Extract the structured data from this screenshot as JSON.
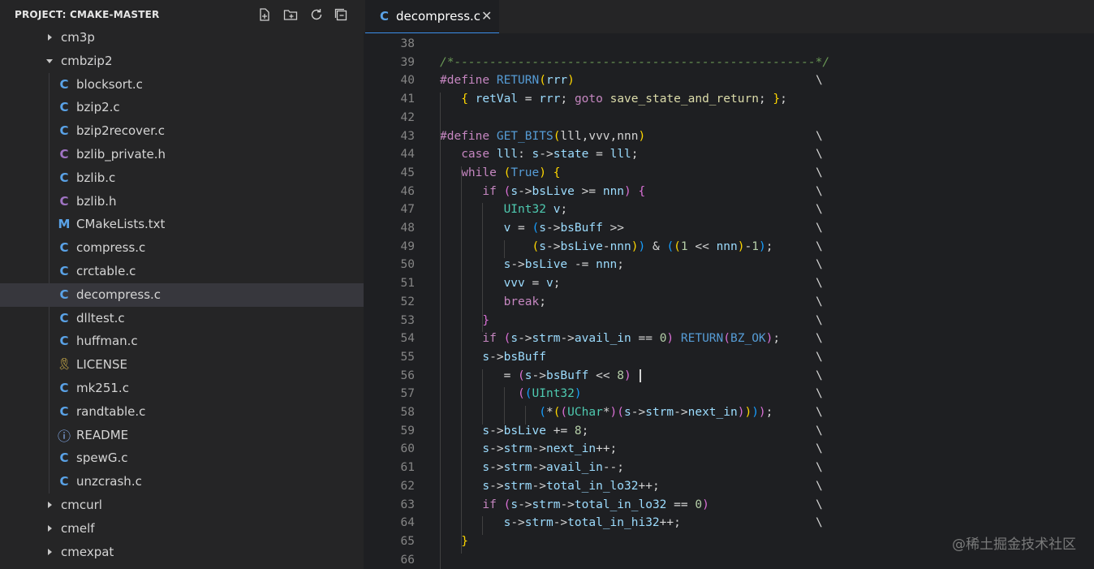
{
  "sidebar": {
    "title": "PROJECT: CMAKE-MASTER",
    "actions": [
      {
        "name": "new-file-icon"
      },
      {
        "name": "new-folder-icon"
      },
      {
        "name": "refresh-icon"
      },
      {
        "name": "collapse-all-icon"
      }
    ],
    "tree": [
      {
        "label": "cm3p",
        "type": "folder",
        "expanded": false
      },
      {
        "label": "cmbzip2",
        "type": "folder",
        "expanded": true
      },
      {
        "label": "blocksort.c",
        "type": "c",
        "icon_glyph": "C"
      },
      {
        "label": "bzip2.c",
        "type": "c",
        "icon_glyph": "C"
      },
      {
        "label": "bzip2recover.c",
        "type": "c",
        "icon_glyph": "C"
      },
      {
        "label": "bzlib_private.h",
        "type": "h",
        "icon_glyph": "C"
      },
      {
        "label": "bzlib.c",
        "type": "c",
        "icon_glyph": "C"
      },
      {
        "label": "bzlib.h",
        "type": "h",
        "icon_glyph": "C"
      },
      {
        "label": "CMakeLists.txt",
        "type": "cmake",
        "icon_glyph": "M"
      },
      {
        "label": "compress.c",
        "type": "c",
        "icon_glyph": "C"
      },
      {
        "label": "crctable.c",
        "type": "c",
        "icon_glyph": "C"
      },
      {
        "label": "decompress.c",
        "type": "c",
        "icon_glyph": "C",
        "selected": true
      },
      {
        "label": "dlltest.c",
        "type": "c",
        "icon_glyph": "C"
      },
      {
        "label": "huffman.c",
        "type": "c",
        "icon_glyph": "C"
      },
      {
        "label": "LICENSE",
        "type": "license",
        "icon_glyph": "🎗"
      },
      {
        "label": "mk251.c",
        "type": "c",
        "icon_glyph": "C"
      },
      {
        "label": "randtable.c",
        "type": "c",
        "icon_glyph": "C"
      },
      {
        "label": "README",
        "type": "info",
        "icon_glyph": "ⓘ"
      },
      {
        "label": "spewG.c",
        "type": "c",
        "icon_glyph": "C"
      },
      {
        "label": "unzcrash.c",
        "type": "c",
        "icon_glyph": "C"
      },
      {
        "label": "cmcurl",
        "type": "folder",
        "expanded": false
      },
      {
        "label": "cmelf",
        "type": "folder",
        "expanded": false
      },
      {
        "label": "cmexpat",
        "type": "folder",
        "expanded": false
      }
    ]
  },
  "tabs": [
    {
      "icon_glyph": "C",
      "label": "decompress.c",
      "close": "✕",
      "active": true
    }
  ],
  "editor": {
    "lines": [
      {
        "n": "38",
        "bs": "",
        "tokens": []
      },
      {
        "n": "39",
        "bs": "",
        "tokens": [
          [
            "t-cm",
            "/*---------------------------------------------------*/"
          ]
        ]
      },
      {
        "n": "40",
        "bs": "\\",
        "tokens": [
          [
            "t-pp",
            "#define "
          ],
          [
            "t-mc",
            "RETURN"
          ],
          [
            "t-br1",
            "("
          ],
          [
            "t-id",
            "rrr"
          ],
          [
            "t-br1",
            ")"
          ]
        ]
      },
      {
        "n": "41",
        "bs": "",
        "tokens": [
          [
            "t-pl",
            "   "
          ],
          [
            "t-br1",
            "{ "
          ],
          [
            "t-id",
            "retVal"
          ],
          [
            "t-pl",
            " = "
          ],
          [
            "t-id",
            "rrr"
          ],
          [
            "t-pl",
            "; "
          ],
          [
            "t-kw",
            "goto"
          ],
          [
            "t-pl",
            " "
          ],
          [
            "t-fn",
            "save_state_and_return"
          ],
          [
            "t-pl",
            "; "
          ],
          [
            "t-br1",
            "}"
          ],
          [
            "t-pl",
            ";"
          ]
        ]
      },
      {
        "n": "42",
        "bs": "",
        "tokens": []
      },
      {
        "n": "43",
        "bs": "\\",
        "tokens": [
          [
            "t-pp",
            "#define "
          ],
          [
            "t-mc",
            "GET_BITS"
          ],
          [
            "t-br1",
            "("
          ],
          [
            "t-pl",
            "lll,vvv,nnn"
          ],
          [
            "t-br1",
            ")"
          ]
        ]
      },
      {
        "n": "44",
        "bs": "\\",
        "tokens": [
          [
            "t-pl",
            "   "
          ],
          [
            "t-kw",
            "case "
          ],
          [
            "t-id",
            "lll"
          ],
          [
            "t-pl",
            ": "
          ],
          [
            "t-id",
            "s"
          ],
          [
            "t-pl",
            "->"
          ],
          [
            "t-id",
            "state"
          ],
          [
            "t-pl",
            " = "
          ],
          [
            "t-id",
            "lll"
          ],
          [
            "t-pl",
            ";"
          ]
        ]
      },
      {
        "n": "45",
        "bs": "\\",
        "tokens": [
          [
            "t-pl",
            "   "
          ],
          [
            "t-kw",
            "while "
          ],
          [
            "t-br1",
            "("
          ],
          [
            "t-mc",
            "True"
          ],
          [
            "t-br1",
            ")"
          ],
          [
            "t-pl",
            " "
          ],
          [
            "t-br1",
            "{"
          ]
        ]
      },
      {
        "n": "46",
        "bs": "\\",
        "tokens": [
          [
            "t-pl",
            "      "
          ],
          [
            "t-kw",
            "if "
          ],
          [
            "t-br2",
            "("
          ],
          [
            "t-id",
            "s"
          ],
          [
            "t-pl",
            "->"
          ],
          [
            "t-id",
            "bsLive"
          ],
          [
            "t-pl",
            " >= "
          ],
          [
            "t-id",
            "nnn"
          ],
          [
            "t-br2",
            ")"
          ],
          [
            "t-pl",
            " "
          ],
          [
            "t-br2",
            "{"
          ]
        ]
      },
      {
        "n": "47",
        "bs": "\\",
        "tokens": [
          [
            "t-pl",
            "         "
          ],
          [
            "t-ty",
            "UInt32"
          ],
          [
            "t-pl",
            " "
          ],
          [
            "t-id",
            "v"
          ],
          [
            "t-pl",
            ";"
          ]
        ]
      },
      {
        "n": "48",
        "bs": "\\",
        "tokens": [
          [
            "t-pl",
            "         "
          ],
          [
            "t-id",
            "v"
          ],
          [
            "t-pl",
            " = "
          ],
          [
            "t-br3",
            "("
          ],
          [
            "t-id",
            "s"
          ],
          [
            "t-pl",
            "->"
          ],
          [
            "t-id",
            "bsBuff"
          ],
          [
            "t-pl",
            " >>"
          ]
        ]
      },
      {
        "n": "49",
        "bs": "\\",
        "tokens": [
          [
            "t-pl",
            "             "
          ],
          [
            "t-br1",
            "("
          ],
          [
            "t-id",
            "s"
          ],
          [
            "t-pl",
            "->"
          ],
          [
            "t-id",
            "bsLive"
          ],
          [
            "t-pl",
            "-"
          ],
          [
            "t-id",
            "nnn"
          ],
          [
            "t-br1",
            ")"
          ],
          [
            "t-br3",
            ")"
          ],
          [
            "t-pl",
            " & "
          ],
          [
            "t-br3",
            "("
          ],
          [
            "t-br1",
            "("
          ],
          [
            "t-nm",
            "1"
          ],
          [
            "t-pl",
            " << "
          ],
          [
            "t-id",
            "nnn"
          ],
          [
            "t-br1",
            ")"
          ],
          [
            "t-pl",
            "-"
          ],
          [
            "t-nm",
            "1"
          ],
          [
            "t-br3",
            ")"
          ],
          [
            "t-pl",
            ";"
          ]
        ]
      },
      {
        "n": "50",
        "bs": "\\",
        "tokens": [
          [
            "t-pl",
            "         "
          ],
          [
            "t-id",
            "s"
          ],
          [
            "t-pl",
            "->"
          ],
          [
            "t-id",
            "bsLive"
          ],
          [
            "t-pl",
            " -= "
          ],
          [
            "t-id",
            "nnn"
          ],
          [
            "t-pl",
            ";"
          ]
        ]
      },
      {
        "n": "51",
        "bs": "\\",
        "tokens": [
          [
            "t-pl",
            "         "
          ],
          [
            "t-id",
            "vvv"
          ],
          [
            "t-pl",
            " = "
          ],
          [
            "t-id",
            "v"
          ],
          [
            "t-pl",
            ";"
          ]
        ]
      },
      {
        "n": "52",
        "bs": "\\",
        "tokens": [
          [
            "t-pl",
            "         "
          ],
          [
            "t-kw",
            "break"
          ],
          [
            "t-pl",
            ";"
          ]
        ]
      },
      {
        "n": "53",
        "bs": "\\",
        "tokens": [
          [
            "t-pl",
            "      "
          ],
          [
            "t-br2",
            "}"
          ]
        ]
      },
      {
        "n": "54",
        "bs": "\\",
        "tokens": [
          [
            "t-pl",
            "      "
          ],
          [
            "t-kw",
            "if "
          ],
          [
            "t-br2",
            "("
          ],
          [
            "t-id",
            "s"
          ],
          [
            "t-pl",
            "->"
          ],
          [
            "t-id",
            "strm"
          ],
          [
            "t-pl",
            "->"
          ],
          [
            "t-id",
            "avail_in"
          ],
          [
            "t-pl",
            " == "
          ],
          [
            "t-nm",
            "0"
          ],
          [
            "t-br2",
            ")"
          ],
          [
            "t-pl",
            " "
          ],
          [
            "t-mc",
            "RETURN"
          ],
          [
            "t-br2",
            "("
          ],
          [
            "t-mc",
            "BZ_OK"
          ],
          [
            "t-br2",
            ")"
          ],
          [
            "t-pl",
            ";"
          ]
        ]
      },
      {
        "n": "55",
        "bs": "\\",
        "tokens": [
          [
            "t-pl",
            "      "
          ],
          [
            "t-id",
            "s"
          ],
          [
            "t-pl",
            "->"
          ],
          [
            "t-id",
            "bsBuff"
          ]
        ]
      },
      {
        "n": "56",
        "bs": "\\",
        "cursor": true,
        "tokens": [
          [
            "t-pl",
            "         = "
          ],
          [
            "t-br2",
            "("
          ],
          [
            "t-id",
            "s"
          ],
          [
            "t-pl",
            "->"
          ],
          [
            "t-id",
            "bsBuff"
          ],
          [
            "t-pl",
            " << "
          ],
          [
            "t-nm",
            "8"
          ],
          [
            "t-br2",
            ")"
          ],
          [
            "t-pl",
            " "
          ]
        ]
      },
      {
        "n": "57",
        "bs": "\\",
        "tokens": [
          [
            "t-pl",
            "           "
          ],
          [
            "t-br2",
            "("
          ],
          [
            "t-br3",
            "("
          ],
          [
            "t-ty",
            "UInt32"
          ],
          [
            "t-br3",
            ")"
          ]
        ]
      },
      {
        "n": "58",
        "bs": "\\",
        "tokens": [
          [
            "t-pl",
            "              "
          ],
          [
            "t-br3",
            "("
          ],
          [
            "t-pl",
            "*"
          ],
          [
            "t-br1",
            "("
          ],
          [
            "t-br2",
            "("
          ],
          [
            "t-ty",
            "UChar"
          ],
          [
            "t-pl",
            "*"
          ],
          [
            "t-br2",
            ")"
          ],
          [
            "t-br2",
            "("
          ],
          [
            "t-id",
            "s"
          ],
          [
            "t-pl",
            "->"
          ],
          [
            "t-id",
            "strm"
          ],
          [
            "t-pl",
            "->"
          ],
          [
            "t-id",
            "next_in"
          ],
          [
            "t-br2",
            ")"
          ],
          [
            "t-br1",
            ")"
          ],
          [
            "t-br3",
            ")"
          ],
          [
            "t-br2",
            ")"
          ],
          [
            "t-pl",
            ";"
          ]
        ]
      },
      {
        "n": "59",
        "bs": "\\",
        "tokens": [
          [
            "t-pl",
            "      "
          ],
          [
            "t-id",
            "s"
          ],
          [
            "t-pl",
            "->"
          ],
          [
            "t-id",
            "bsLive"
          ],
          [
            "t-pl",
            " += "
          ],
          [
            "t-nm",
            "8"
          ],
          [
            "t-pl",
            ";"
          ]
        ]
      },
      {
        "n": "60",
        "bs": "\\",
        "tokens": [
          [
            "t-pl",
            "      "
          ],
          [
            "t-id",
            "s"
          ],
          [
            "t-pl",
            "->"
          ],
          [
            "t-id",
            "strm"
          ],
          [
            "t-pl",
            "->"
          ],
          [
            "t-id",
            "next_in"
          ],
          [
            "t-pl",
            "++;"
          ]
        ]
      },
      {
        "n": "61",
        "bs": "\\",
        "tokens": [
          [
            "t-pl",
            "      "
          ],
          [
            "t-id",
            "s"
          ],
          [
            "t-pl",
            "->"
          ],
          [
            "t-id",
            "strm"
          ],
          [
            "t-pl",
            "->"
          ],
          [
            "t-id",
            "avail_in"
          ],
          [
            "t-pl",
            "--;"
          ]
        ]
      },
      {
        "n": "62",
        "bs": "\\",
        "tokens": [
          [
            "t-pl",
            "      "
          ],
          [
            "t-id",
            "s"
          ],
          [
            "t-pl",
            "->"
          ],
          [
            "t-id",
            "strm"
          ],
          [
            "t-pl",
            "->"
          ],
          [
            "t-id",
            "total_in_lo32"
          ],
          [
            "t-pl",
            "++;"
          ]
        ]
      },
      {
        "n": "63",
        "bs": "\\",
        "tokens": [
          [
            "t-pl",
            "      "
          ],
          [
            "t-kw",
            "if "
          ],
          [
            "t-br2",
            "("
          ],
          [
            "t-id",
            "s"
          ],
          [
            "t-pl",
            "->"
          ],
          [
            "t-id",
            "strm"
          ],
          [
            "t-pl",
            "->"
          ],
          [
            "t-id",
            "total_in_lo32"
          ],
          [
            "t-pl",
            " == "
          ],
          [
            "t-nm",
            "0"
          ],
          [
            "t-br2",
            ")"
          ]
        ]
      },
      {
        "n": "64",
        "bs": "\\",
        "tokens": [
          [
            "t-pl",
            "         "
          ],
          [
            "t-id",
            "s"
          ],
          [
            "t-pl",
            "->"
          ],
          [
            "t-id",
            "strm"
          ],
          [
            "t-pl",
            "->"
          ],
          [
            "t-id",
            "total_in_hi32"
          ],
          [
            "t-pl",
            "++;"
          ]
        ]
      },
      {
        "n": "65",
        "bs": "",
        "tokens": [
          [
            "t-pl",
            "   "
          ],
          [
            "t-br1",
            "}"
          ]
        ]
      },
      {
        "n": "66",
        "bs": "",
        "tokens": []
      }
    ]
  },
  "watermark": "@稀土掘金技术社区",
  "colors": {
    "accent": "#3b8eea",
    "c_icon": "#5aa3e8",
    "h_icon": "#a074c4",
    "cmake_icon": "#5aa3e8",
    "license_icon": "#d4b34a",
    "info_icon": "#8ab4f8"
  }
}
